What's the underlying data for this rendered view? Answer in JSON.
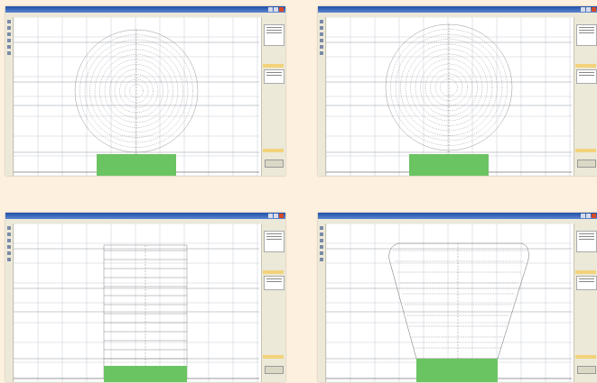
{
  "colors": {
    "background": "#fdf0de",
    "window_title": "#1e4fa6",
    "base_block": "#6bc462",
    "grid": "#b8c0cc",
    "contour": "#6a6a6a",
    "panel_highlight": "#f2d37a"
  },
  "windows": [
    {
      "id": "top-left",
      "title": "",
      "menu": "",
      "shape": "rounded-bulb"
    },
    {
      "id": "top-right",
      "title": "",
      "menu": "",
      "shape": "round-bulb"
    },
    {
      "id": "bottom-left",
      "title": "",
      "menu": "",
      "shape": "rectangle-stack"
    },
    {
      "id": "bottom-right",
      "title": "",
      "menu": "",
      "shape": "tapered-cup"
    }
  ],
  "icons": {
    "close": "close-icon",
    "minimize": "minimize-icon",
    "maximize": "maximize-icon",
    "tool": "tool-icon"
  }
}
